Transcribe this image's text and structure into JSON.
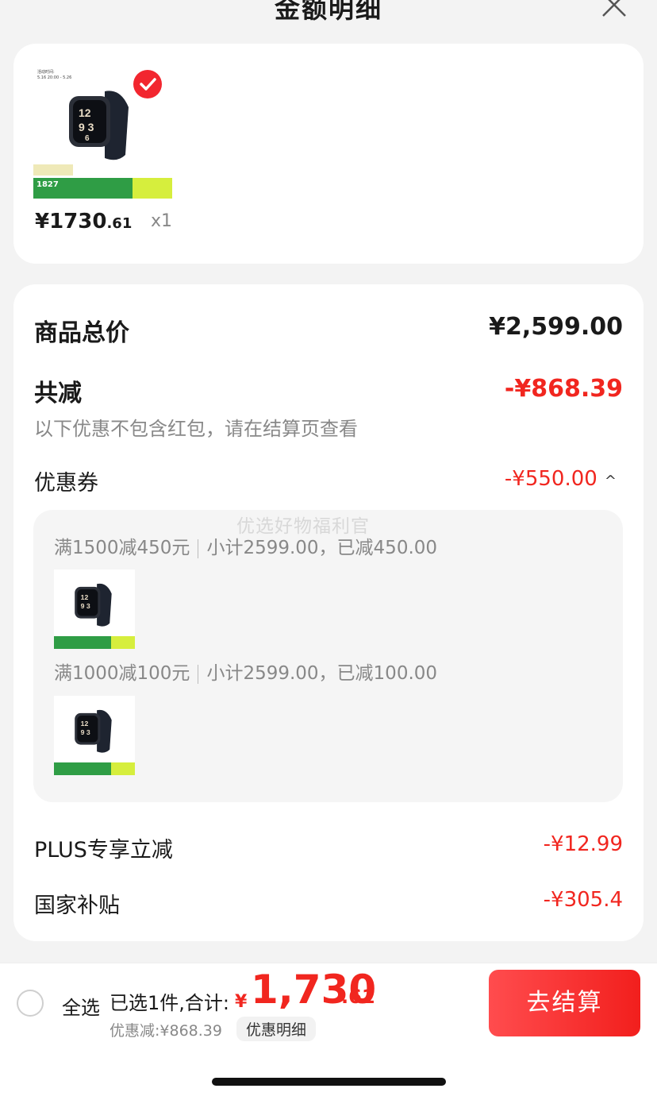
{
  "header": {
    "title": "金额明细"
  },
  "product": {
    "thumb_date_label": "活动时间:",
    "thumb_date": "5.16 20:00 - 5.26",
    "thumb_price": "1827",
    "price_int": "¥1730",
    "price_dec": ".61",
    "qty": "x1"
  },
  "summary": {
    "total_label": "商品总价",
    "total_value": "¥2,599.00",
    "reduce_label": "共减",
    "reduce_value": "-¥868.39",
    "note": "以下优惠不包含红包，请在结算页查看",
    "coupon_label": "优惠券",
    "coupon_value": "-¥550.00",
    "coupon_arrow": "^",
    "watermark": "优选好物福利官",
    "coupons": [
      {
        "rule": "满1500减450元",
        "detail": "小计2599.00，已减450.00"
      },
      {
        "rule": "满1000减100元",
        "detail": "小计2599.00，已减100.00"
      }
    ],
    "plus_label": "PLUS专享立减",
    "plus_value": "-¥12.99",
    "subsidy_label": "国家补贴",
    "subsidy_value": "-¥305.4"
  },
  "bottom_bar": {
    "select_all": "全选",
    "selected_text": "已选1件,合计:",
    "total_yen": "¥",
    "total_int": "1,730",
    "total_dec": ".61",
    "discount_text": "优惠减:¥868.39",
    "discount_detail": "优惠明细",
    "checkout": "去结算"
  },
  "colors": {
    "accent": "#f1261f",
    "checkout_from": "#ff4c4e",
    "checkout_to": "#f21f1d"
  }
}
